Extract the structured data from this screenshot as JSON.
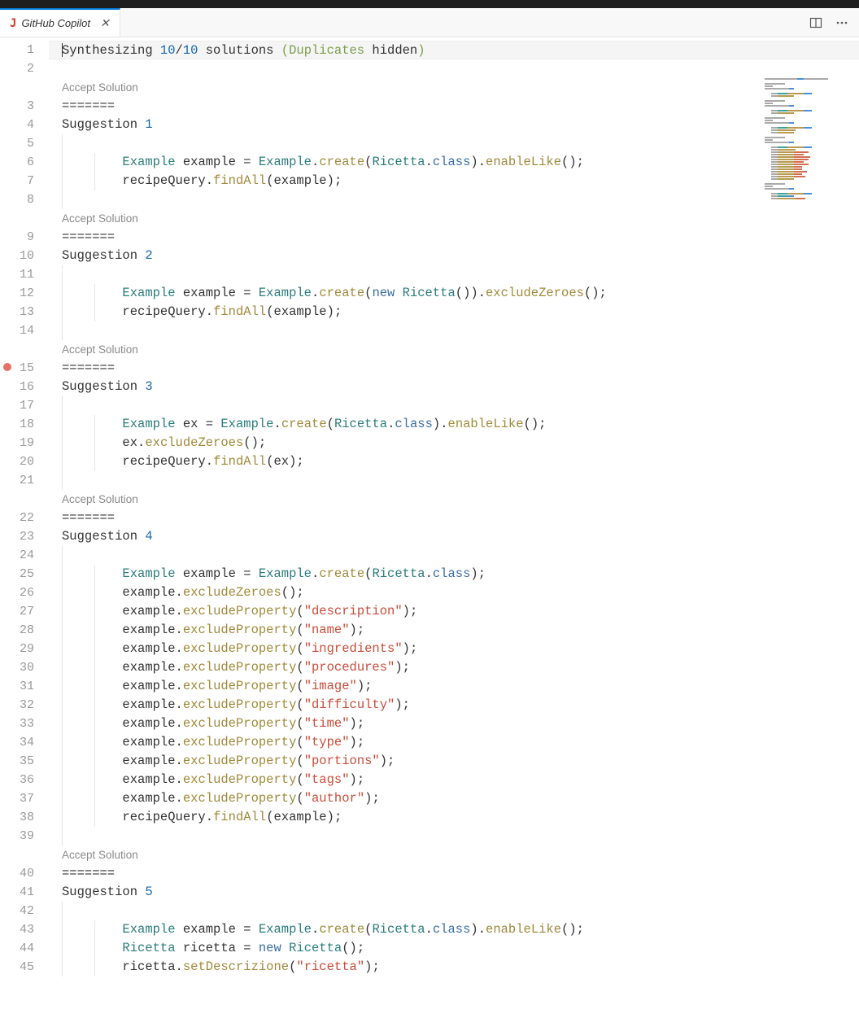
{
  "tab": {
    "icon": "J",
    "title": "GitHub Copilot",
    "close_icon": "close-icon"
  },
  "actions": {
    "split_editor": "split-editor-icon",
    "more": "more-icon"
  },
  "synthesis": {
    "prefix": "Synthesizing ",
    "count_done": "10",
    "slash": "/",
    "count_total": "10",
    "mid": " solutions ",
    "dup_open": "(",
    "dup_label": "Duplicates",
    "dup_mid": " ",
    "dup_word": "hidden",
    "dup_close": ")"
  },
  "accept_label": "Accept Solution",
  "sep": "=======",
  "suggestion_label": "Suggestion ",
  "suggestions": [
    {
      "n": "1",
      "code": [
        [
          [
            "c-type",
            "Example"
          ],
          [
            "c-ident",
            " example "
          ],
          [
            "c-op",
            "= "
          ],
          [
            "c-type",
            "Example"
          ],
          [
            "c-dot",
            "."
          ],
          [
            "c-method",
            "create"
          ],
          [
            "c-brace",
            "("
          ],
          [
            "c-type",
            "Ricetta"
          ],
          [
            "c-dot",
            "."
          ],
          [
            "c-kw",
            "class"
          ],
          [
            "c-brace",
            ")"
          ],
          [
            "c-dot",
            "."
          ],
          [
            "c-method",
            "enableLike"
          ],
          [
            "c-brace",
            "()"
          ],
          [
            "c-op",
            ";"
          ]
        ],
        [
          [
            "c-ident",
            "recipeQuery"
          ],
          [
            "c-dot",
            "."
          ],
          [
            "c-method",
            "findAll"
          ],
          [
            "c-brace",
            "("
          ],
          [
            "c-ident",
            "example"
          ],
          [
            "c-brace",
            ")"
          ],
          [
            "c-op",
            ";"
          ]
        ]
      ]
    },
    {
      "n": "2",
      "code": [
        [
          [
            "c-type",
            "Example"
          ],
          [
            "c-ident",
            " example "
          ],
          [
            "c-op",
            "= "
          ],
          [
            "c-type",
            "Example"
          ],
          [
            "c-dot",
            "."
          ],
          [
            "c-method",
            "create"
          ],
          [
            "c-brace",
            "("
          ],
          [
            "c-kw",
            "new "
          ],
          [
            "c-type",
            "Ricetta"
          ],
          [
            "c-brace",
            "())"
          ],
          [
            "c-dot",
            "."
          ],
          [
            "c-method",
            "excludeZeroes"
          ],
          [
            "c-brace",
            "()"
          ],
          [
            "c-op",
            ";"
          ]
        ],
        [
          [
            "c-ident",
            "recipeQuery"
          ],
          [
            "c-dot",
            "."
          ],
          [
            "c-method",
            "findAll"
          ],
          [
            "c-brace",
            "("
          ],
          [
            "c-ident",
            "example"
          ],
          [
            "c-brace",
            ")"
          ],
          [
            "c-op",
            ";"
          ]
        ]
      ]
    },
    {
      "n": "3",
      "code": [
        [
          [
            "c-type",
            "Example"
          ],
          [
            "c-ident",
            " ex "
          ],
          [
            "c-op",
            "= "
          ],
          [
            "c-type",
            "Example"
          ],
          [
            "c-dot",
            "."
          ],
          [
            "c-method",
            "create"
          ],
          [
            "c-brace",
            "("
          ],
          [
            "c-type",
            "Ricetta"
          ],
          [
            "c-dot",
            "."
          ],
          [
            "c-kw",
            "class"
          ],
          [
            "c-brace",
            ")"
          ],
          [
            "c-dot",
            "."
          ],
          [
            "c-method",
            "enableLike"
          ],
          [
            "c-brace",
            "()"
          ],
          [
            "c-op",
            ";"
          ]
        ],
        [
          [
            "c-ident",
            "ex"
          ],
          [
            "c-dot",
            "."
          ],
          [
            "c-method",
            "excludeZeroes"
          ],
          [
            "c-brace",
            "()"
          ],
          [
            "c-op",
            ";"
          ]
        ],
        [
          [
            "c-ident",
            "recipeQuery"
          ],
          [
            "c-dot",
            "."
          ],
          [
            "c-method",
            "findAll"
          ],
          [
            "c-brace",
            "("
          ],
          [
            "c-ident",
            "ex"
          ],
          [
            "c-brace",
            ")"
          ],
          [
            "c-op",
            ";"
          ]
        ]
      ]
    },
    {
      "n": "4",
      "code": [
        [
          [
            "c-type",
            "Example"
          ],
          [
            "c-ident",
            " example "
          ],
          [
            "c-op",
            "= "
          ],
          [
            "c-type",
            "Example"
          ],
          [
            "c-dot",
            "."
          ],
          [
            "c-method",
            "create"
          ],
          [
            "c-brace",
            "("
          ],
          [
            "c-type",
            "Ricetta"
          ],
          [
            "c-dot",
            "."
          ],
          [
            "c-kw",
            "class"
          ],
          [
            "c-brace",
            ")"
          ],
          [
            "c-op",
            ";"
          ]
        ],
        [
          [
            "c-ident",
            "example"
          ],
          [
            "c-dot",
            "."
          ],
          [
            "c-method",
            "excludeZeroes"
          ],
          [
            "c-brace",
            "()"
          ],
          [
            "c-op",
            ";"
          ]
        ],
        [
          [
            "c-ident",
            "example"
          ],
          [
            "c-dot",
            "."
          ],
          [
            "c-method",
            "excludeProperty"
          ],
          [
            "c-brace",
            "("
          ],
          [
            "c-str",
            "\"description\""
          ],
          [
            "c-brace",
            ")"
          ],
          [
            "c-op",
            ";"
          ]
        ],
        [
          [
            "c-ident",
            "example"
          ],
          [
            "c-dot",
            "."
          ],
          [
            "c-method",
            "excludeProperty"
          ],
          [
            "c-brace",
            "("
          ],
          [
            "c-str",
            "\"name\""
          ],
          [
            "c-brace",
            ")"
          ],
          [
            "c-op",
            ";"
          ]
        ],
        [
          [
            "c-ident",
            "example"
          ],
          [
            "c-dot",
            "."
          ],
          [
            "c-method",
            "excludeProperty"
          ],
          [
            "c-brace",
            "("
          ],
          [
            "c-str",
            "\"ingredients\""
          ],
          [
            "c-brace",
            ")"
          ],
          [
            "c-op",
            ";"
          ]
        ],
        [
          [
            "c-ident",
            "example"
          ],
          [
            "c-dot",
            "."
          ],
          [
            "c-method",
            "excludeProperty"
          ],
          [
            "c-brace",
            "("
          ],
          [
            "c-str",
            "\"procedures\""
          ],
          [
            "c-brace",
            ")"
          ],
          [
            "c-op",
            ";"
          ]
        ],
        [
          [
            "c-ident",
            "example"
          ],
          [
            "c-dot",
            "."
          ],
          [
            "c-method",
            "excludeProperty"
          ],
          [
            "c-brace",
            "("
          ],
          [
            "c-str",
            "\"image\""
          ],
          [
            "c-brace",
            ")"
          ],
          [
            "c-op",
            ";"
          ]
        ],
        [
          [
            "c-ident",
            "example"
          ],
          [
            "c-dot",
            "."
          ],
          [
            "c-method",
            "excludeProperty"
          ],
          [
            "c-brace",
            "("
          ],
          [
            "c-str",
            "\"difficulty\""
          ],
          [
            "c-brace",
            ")"
          ],
          [
            "c-op",
            ";"
          ]
        ],
        [
          [
            "c-ident",
            "example"
          ],
          [
            "c-dot",
            "."
          ],
          [
            "c-method",
            "excludeProperty"
          ],
          [
            "c-brace",
            "("
          ],
          [
            "c-str",
            "\"time\""
          ],
          [
            "c-brace",
            ")"
          ],
          [
            "c-op",
            ";"
          ]
        ],
        [
          [
            "c-ident",
            "example"
          ],
          [
            "c-dot",
            "."
          ],
          [
            "c-method",
            "excludeProperty"
          ],
          [
            "c-brace",
            "("
          ],
          [
            "c-str",
            "\"type\""
          ],
          [
            "c-brace",
            ")"
          ],
          [
            "c-op",
            ";"
          ]
        ],
        [
          [
            "c-ident",
            "example"
          ],
          [
            "c-dot",
            "."
          ],
          [
            "c-method",
            "excludeProperty"
          ],
          [
            "c-brace",
            "("
          ],
          [
            "c-str",
            "\"portions\""
          ],
          [
            "c-brace",
            ")"
          ],
          [
            "c-op",
            ";"
          ]
        ],
        [
          [
            "c-ident",
            "example"
          ],
          [
            "c-dot",
            "."
          ],
          [
            "c-method",
            "excludeProperty"
          ],
          [
            "c-brace",
            "("
          ],
          [
            "c-str",
            "\"tags\""
          ],
          [
            "c-brace",
            ")"
          ],
          [
            "c-op",
            ";"
          ]
        ],
        [
          [
            "c-ident",
            "example"
          ],
          [
            "c-dot",
            "."
          ],
          [
            "c-method",
            "excludeProperty"
          ],
          [
            "c-brace",
            "("
          ],
          [
            "c-str",
            "\"author\""
          ],
          [
            "c-brace",
            ")"
          ],
          [
            "c-op",
            ";"
          ]
        ],
        [
          [
            "c-ident",
            "recipeQuery"
          ],
          [
            "c-dot",
            "."
          ],
          [
            "c-method",
            "findAll"
          ],
          [
            "c-brace",
            "("
          ],
          [
            "c-ident",
            "example"
          ],
          [
            "c-brace",
            ")"
          ],
          [
            "c-op",
            ";"
          ]
        ]
      ]
    },
    {
      "n": "5",
      "code": [
        [
          [
            "c-type",
            "Example"
          ],
          [
            "c-ident",
            " example "
          ],
          [
            "c-op",
            "= "
          ],
          [
            "c-type",
            "Example"
          ],
          [
            "c-dot",
            "."
          ],
          [
            "c-method",
            "create"
          ],
          [
            "c-brace",
            "("
          ],
          [
            "c-type",
            "Ricetta"
          ],
          [
            "c-dot",
            "."
          ],
          [
            "c-kw",
            "class"
          ],
          [
            "c-brace",
            ")"
          ],
          [
            "c-dot",
            "."
          ],
          [
            "c-method",
            "enableLike"
          ],
          [
            "c-brace",
            "()"
          ],
          [
            "c-op",
            ";"
          ]
        ],
        [
          [
            "c-type",
            "Ricetta"
          ],
          [
            "c-ident",
            " ricetta "
          ],
          [
            "c-op",
            "= "
          ],
          [
            "c-kw",
            "new "
          ],
          [
            "c-type",
            "Ricetta"
          ],
          [
            "c-brace",
            "()"
          ],
          [
            "c-op",
            ";"
          ]
        ],
        [
          [
            "c-ident",
            "ricetta"
          ],
          [
            "c-dot",
            "."
          ],
          [
            "c-method",
            "setDescrizione"
          ],
          [
            "c-brace",
            "("
          ],
          [
            "c-str",
            "\"ricetta\""
          ],
          [
            "c-brace",
            ")"
          ],
          [
            "c-op",
            ";"
          ]
        ]
      ]
    }
  ],
  "line_numbers": [
    "1",
    "2",
    "",
    "3",
    "4",
    "5",
    "6",
    "7",
    "8",
    "",
    "9",
    "10",
    "11",
    "12",
    "13",
    "14",
    "",
    "15",
    "16",
    "17",
    "18",
    "19",
    "20",
    "21",
    "",
    "22",
    "23",
    "24",
    "25",
    "26",
    "27",
    "28",
    "29",
    "30",
    "31",
    "32",
    "33",
    "34",
    "35",
    "36",
    "37",
    "38",
    "39",
    "",
    "40",
    "41",
    "42",
    "43",
    "44",
    "45"
  ],
  "breakpoint_at": "15"
}
